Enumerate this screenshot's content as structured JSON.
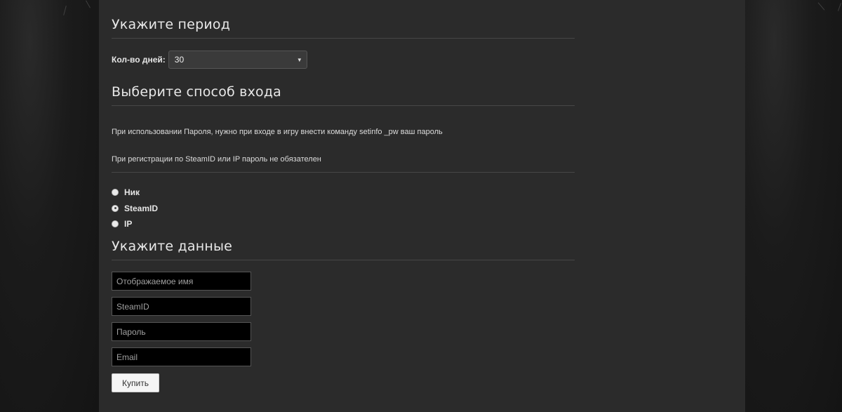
{
  "period": {
    "heading": "Укажите период",
    "days_label": "Кол-во дней:",
    "days_value": "30"
  },
  "login_method": {
    "heading": "Выберите способ входа",
    "note_password": "При использовании Пароля, нужно при входе в игру внести команду setinfo _pw ваш пароль",
    "note_steamid": "При регистрации по SteamID или IP пароль не обязателен",
    "options": [
      {
        "label": "Ник",
        "checked": false
      },
      {
        "label": "SteamID",
        "checked": true
      },
      {
        "label": "IP",
        "checked": false
      }
    ]
  },
  "details": {
    "heading": "Укажите данные",
    "name_placeholder": "Отображаемое имя",
    "steamid_placeholder": "SteamID",
    "password_placeholder": "Пароль",
    "email_placeholder": "Email",
    "buy_label": "Купить"
  }
}
